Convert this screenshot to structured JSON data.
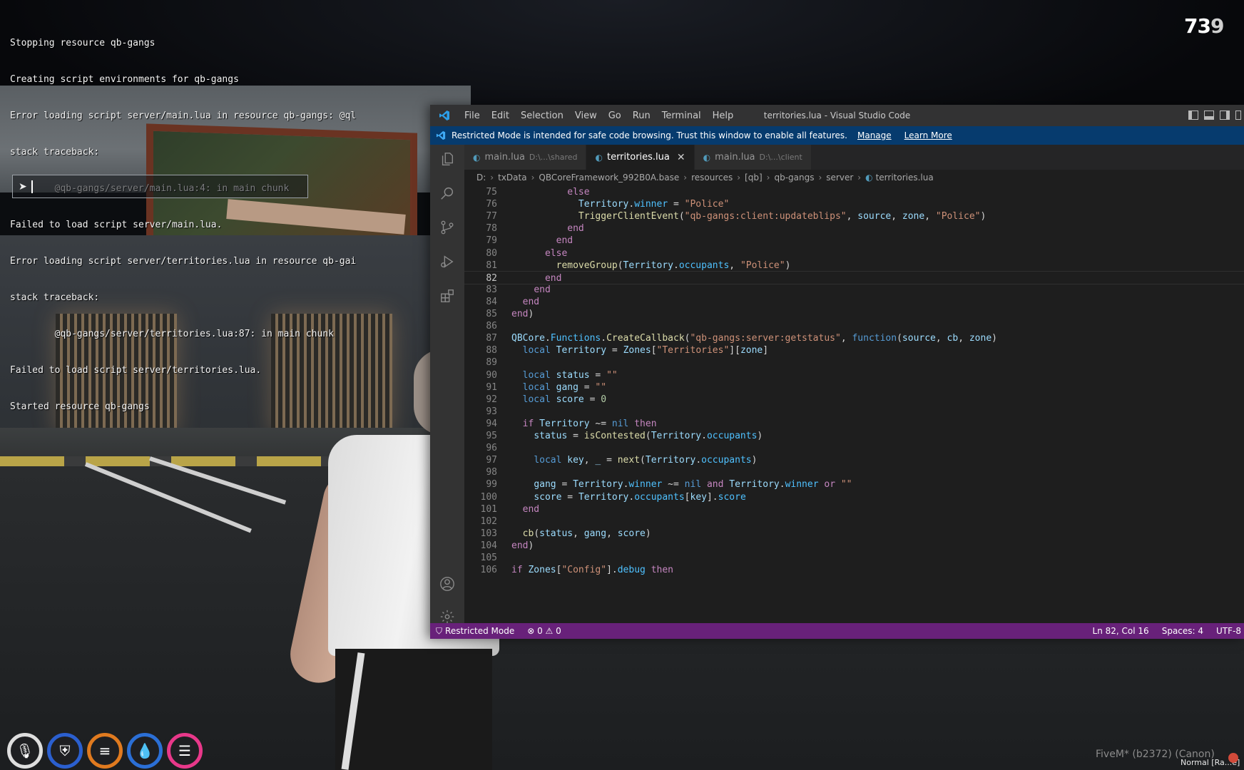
{
  "console": {
    "lines": [
      "Stopping resource qb-gangs",
      "Creating script environments for qb-gangs",
      "Error loading script server/main.lua in resource qb-gangs: @ql",
      "stack traceback:",
      "        @qb-gangs/server/main.lua:4: in main chunk",
      "Failed to load script server/main.lua.",
      "Error loading script server/territories.lua in resource qb-gai",
      "stack traceback:",
      "        @qb-gangs/server/territories.lua:87: in main chunk",
      "Failed to load script server/territories.lua.",
      "Started resource qb-gangs"
    ],
    "prompt_icon": "play-arrow-icon",
    "input_value": ""
  },
  "fps": {
    "main": "73",
    "dim": "9"
  },
  "hud": {
    "items": [
      {
        "name": "microphone",
        "glyph": "🎙",
        "color": "#dedede"
      },
      {
        "name": "armor",
        "glyph": "⛨",
        "color": "#2b5fcf"
      },
      {
        "name": "hunger",
        "glyph": "≡",
        "color": "#e07a1f"
      },
      {
        "name": "thirst",
        "glyph": "💧",
        "color": "#2b6fd6"
      },
      {
        "name": "stress",
        "glyph": "☰",
        "color": "#e8388a"
      }
    ]
  },
  "fivem": {
    "footer": "FiveM* (b2372) (Canon)",
    "mode": "Normal [Ra...e]"
  },
  "vscode": {
    "menu": [
      "File",
      "Edit",
      "Selection",
      "View",
      "Go",
      "Run",
      "Terminal",
      "Help"
    ],
    "window_title": "territories.lua - Visual Studio Code",
    "banner": {
      "message": "Restricted Mode is intended for safe code browsing. Trust this window to enable all features.",
      "manage": "Manage",
      "learn_more": "Learn More"
    },
    "tabs": [
      {
        "label": "main.lua",
        "path": "D:\\...\\shared",
        "active": false
      },
      {
        "label": "territories.lua",
        "path": "",
        "active": true
      },
      {
        "label": "main.lua",
        "path": "D:\\...\\client",
        "active": false
      }
    ],
    "breadcrumb": [
      "D:",
      "txData",
      "QBCoreFramework_992B0A.base",
      "resources",
      "[qb]",
      "qb-gangs",
      "server",
      "territories.lua"
    ],
    "current_line": 82,
    "code": [
      {
        "n": "75",
        "indent": 10,
        "t": [
          [
            "kw",
            "else"
          ]
        ]
      },
      {
        "n": "76",
        "indent": 12,
        "t": [
          [
            "var",
            "Territory"
          ],
          [
            "p",
            "."
          ],
          [
            "prop",
            "winner"
          ],
          [
            "p",
            " = "
          ],
          [
            "str",
            "\"Police\""
          ]
        ]
      },
      {
        "n": "77",
        "indent": 12,
        "t": [
          [
            "fn",
            "TriggerClientEvent"
          ],
          [
            "p",
            "("
          ],
          [
            "str",
            "\"qb-gangs:client:updateblips\""
          ],
          [
            "p",
            ", "
          ],
          [
            "var",
            "source"
          ],
          [
            "p",
            ", "
          ],
          [
            "var",
            "zone"
          ],
          [
            "p",
            ", "
          ],
          [
            "str",
            "\"Police\""
          ],
          [
            "p",
            ")"
          ]
        ]
      },
      {
        "n": "78",
        "indent": 10,
        "t": [
          [
            "kw",
            "end"
          ]
        ]
      },
      {
        "n": "79",
        "indent": 8,
        "t": [
          [
            "kw",
            "end"
          ]
        ]
      },
      {
        "n": "80",
        "indent": 6,
        "t": [
          [
            "kw",
            "else"
          ]
        ]
      },
      {
        "n": "81",
        "indent": 8,
        "t": [
          [
            "fn",
            "removeGroup"
          ],
          [
            "p",
            "("
          ],
          [
            "var",
            "Territory"
          ],
          [
            "p",
            "."
          ],
          [
            "prop",
            "occupants"
          ],
          [
            "p",
            ", "
          ],
          [
            "str",
            "\"Police\""
          ],
          [
            "p",
            ")"
          ]
        ]
      },
      {
        "n": "82",
        "indent": 6,
        "t": [
          [
            "kw",
            "end"
          ]
        ]
      },
      {
        "n": "83",
        "indent": 4,
        "t": [
          [
            "kw",
            "end"
          ]
        ]
      },
      {
        "n": "84",
        "indent": 2,
        "t": [
          [
            "kw",
            "end"
          ]
        ]
      },
      {
        "n": "85",
        "indent": 0,
        "t": [
          [
            "kw",
            "end"
          ],
          [
            "p",
            ")"
          ]
        ]
      },
      {
        "n": "86",
        "indent": 0,
        "t": []
      },
      {
        "n": "87",
        "indent": 0,
        "t": [
          [
            "var",
            "QBCore"
          ],
          [
            "p",
            "."
          ],
          [
            "prop",
            "Functions"
          ],
          [
            "p",
            "."
          ],
          [
            "fn",
            "CreateCallback"
          ],
          [
            "p",
            "("
          ],
          [
            "str",
            "\"qb-gangs:server:getstatus\""
          ],
          [
            "p",
            ", "
          ],
          [
            "kw2",
            "function"
          ],
          [
            "p",
            "("
          ],
          [
            "var",
            "source"
          ],
          [
            "p",
            ", "
          ],
          [
            "var",
            "cb"
          ],
          [
            "p",
            ", "
          ],
          [
            "var",
            "zone"
          ],
          [
            "p",
            ")"
          ]
        ]
      },
      {
        "n": "88",
        "indent": 2,
        "t": [
          [
            "kw2",
            "local"
          ],
          [
            "p",
            " "
          ],
          [
            "var",
            "Territory"
          ],
          [
            "p",
            " = "
          ],
          [
            "var",
            "Zones"
          ],
          [
            "p",
            "["
          ],
          [
            "str",
            "\"Territories\""
          ],
          [
            "p",
            "]["
          ],
          [
            "var",
            "zone"
          ],
          [
            "p",
            "]"
          ]
        ]
      },
      {
        "n": "89",
        "indent": 0,
        "t": []
      },
      {
        "n": "90",
        "indent": 2,
        "t": [
          [
            "kw2",
            "local"
          ],
          [
            "p",
            " "
          ],
          [
            "var",
            "status"
          ],
          [
            "p",
            " = "
          ],
          [
            "str",
            "\"\""
          ]
        ]
      },
      {
        "n": "91",
        "indent": 2,
        "t": [
          [
            "kw2",
            "local"
          ],
          [
            "p",
            " "
          ],
          [
            "var",
            "gang"
          ],
          [
            "p",
            " = "
          ],
          [
            "str",
            "\"\""
          ]
        ]
      },
      {
        "n": "92",
        "indent": 2,
        "t": [
          [
            "kw2",
            "local"
          ],
          [
            "p",
            " "
          ],
          [
            "var",
            "score"
          ],
          [
            "p",
            " = "
          ],
          [
            "num",
            "0"
          ]
        ]
      },
      {
        "n": "93",
        "indent": 0,
        "t": []
      },
      {
        "n": "94",
        "indent": 2,
        "t": [
          [
            "kw",
            "if"
          ],
          [
            "p",
            " "
          ],
          [
            "var",
            "Territory"
          ],
          [
            "p",
            " ~= "
          ],
          [
            "kw2",
            "nil"
          ],
          [
            "p",
            " "
          ],
          [
            "kw",
            "then"
          ]
        ]
      },
      {
        "n": "95",
        "indent": 4,
        "t": [
          [
            "var",
            "status"
          ],
          [
            "p",
            " = "
          ],
          [
            "fn",
            "isContested"
          ],
          [
            "p",
            "("
          ],
          [
            "var",
            "Territory"
          ],
          [
            "p",
            "."
          ],
          [
            "prop",
            "occupants"
          ],
          [
            "p",
            ")"
          ]
        ]
      },
      {
        "n": "96",
        "indent": 0,
        "t": []
      },
      {
        "n": "97",
        "indent": 4,
        "t": [
          [
            "kw2",
            "local"
          ],
          [
            "p",
            " "
          ],
          [
            "var",
            "key"
          ],
          [
            "p",
            ", "
          ],
          [
            "var",
            "_"
          ],
          [
            "p",
            " = "
          ],
          [
            "fn",
            "next"
          ],
          [
            "p",
            "("
          ],
          [
            "var",
            "Territory"
          ],
          [
            "p",
            "."
          ],
          [
            "prop",
            "occupants"
          ],
          [
            "p",
            ")"
          ]
        ]
      },
      {
        "n": "98",
        "indent": 0,
        "t": []
      },
      {
        "n": "99",
        "indent": 4,
        "t": [
          [
            "var",
            "gang"
          ],
          [
            "p",
            " = "
          ],
          [
            "var",
            "Territory"
          ],
          [
            "p",
            "."
          ],
          [
            "prop",
            "winner"
          ],
          [
            "p",
            " ~= "
          ],
          [
            "kw2",
            "nil"
          ],
          [
            "p",
            " "
          ],
          [
            "kw",
            "and"
          ],
          [
            "p",
            " "
          ],
          [
            "var",
            "Territory"
          ],
          [
            "p",
            "."
          ],
          [
            "prop",
            "winner"
          ],
          [
            "p",
            " "
          ],
          [
            "kw",
            "or"
          ],
          [
            "p",
            " "
          ],
          [
            "str",
            "\"\""
          ]
        ]
      },
      {
        "n": "100",
        "indent": 4,
        "t": [
          [
            "var",
            "score"
          ],
          [
            "p",
            " = "
          ],
          [
            "var",
            "Territory"
          ],
          [
            "p",
            "."
          ],
          [
            "prop",
            "occupants"
          ],
          [
            "p",
            "["
          ],
          [
            "var",
            "key"
          ],
          [
            "p",
            "]."
          ],
          [
            "prop",
            "score"
          ]
        ]
      },
      {
        "n": "101",
        "indent": 2,
        "t": [
          [
            "kw",
            "end"
          ]
        ]
      },
      {
        "n": "102",
        "indent": 0,
        "t": []
      },
      {
        "n": "103",
        "indent": 2,
        "t": [
          [
            "fn",
            "cb"
          ],
          [
            "p",
            "("
          ],
          [
            "var",
            "status"
          ],
          [
            "p",
            ", "
          ],
          [
            "var",
            "gang"
          ],
          [
            "p",
            ", "
          ],
          [
            "var",
            "score"
          ],
          [
            "p",
            ")"
          ]
        ]
      },
      {
        "n": "104",
        "indent": 0,
        "t": [
          [
            "kw",
            "end"
          ],
          [
            "p",
            ")"
          ]
        ]
      },
      {
        "n": "105",
        "indent": 0,
        "t": []
      },
      {
        "n": "106",
        "indent": 0,
        "t": [
          [
            "kw",
            "if"
          ],
          [
            "p",
            " "
          ],
          [
            "var",
            "Zones"
          ],
          [
            "p",
            "["
          ],
          [
            "str",
            "\"Config\""
          ],
          [
            "p",
            "]."
          ],
          [
            "prop",
            "debug"
          ],
          [
            "p",
            " "
          ],
          [
            "kw",
            "then"
          ]
        ]
      }
    ],
    "syntax_colors": {
      "kw": "#c586c0",
      "kw2": "#569cd6",
      "var": "#9cdcfe",
      "prop": "#4fc1ff",
      "fn": "#dcdcaa",
      "str": "#ce9178",
      "num": "#b5cea8",
      "p": "#d4d4d4"
    },
    "status": {
      "restricted": "Restricted Mode",
      "problems": "⊗ 0 ⚠ 0",
      "position": "Ln 82, Col 16",
      "spaces": "Spaces: 4",
      "encoding": "UTF-8"
    }
  }
}
